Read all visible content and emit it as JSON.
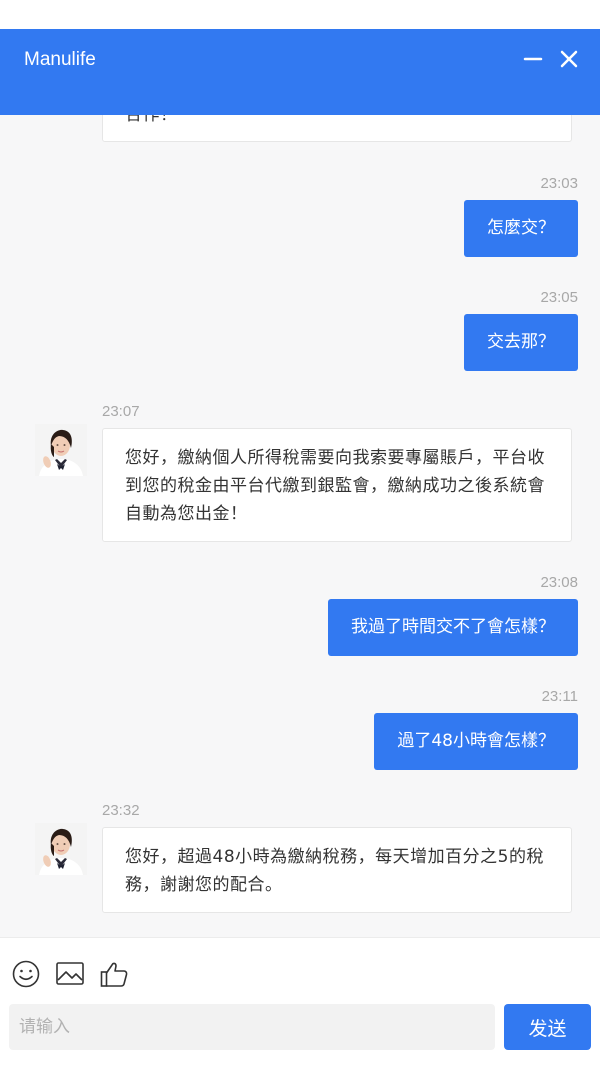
{
  "header": {
    "title": "Manulife",
    "minimize_icon": "minus-icon",
    "close_icon": "close-icon",
    "background": "#3279f1"
  },
  "messages": [
    {
      "direction": "in",
      "text": "合作！",
      "partial": true
    },
    {
      "direction": "out",
      "time": "23:03",
      "text": "怎麼交？"
    },
    {
      "direction": "out",
      "time": "23:05",
      "text": "交去那？"
    },
    {
      "direction": "in",
      "time": "23:07",
      "text": "您好，繳納個人所得稅需要向我索要專屬賬戶，平台收到您的稅金由平台代繳到銀監會，繳納成功之後系統會自動為您出金！"
    },
    {
      "direction": "out",
      "time": "23:08",
      "text": "我過了時間交不了會怎樣？"
    },
    {
      "direction": "out",
      "time": "23:11",
      "text": "過了48小時會怎樣？"
    },
    {
      "direction": "in",
      "time": "23:32",
      "text": "您好，超過48小時為繳納稅務，每天增加百分之5的稅務，謝謝您的配合。"
    }
  ],
  "toolbar": {
    "emoji_icon": "smiley-icon",
    "image_icon": "image-icon",
    "like_icon": "thumbs-up-icon"
  },
  "input": {
    "placeholder": "请输入",
    "value": ""
  },
  "send_label": "发送",
  "colors": {
    "accent": "#3279f1",
    "chat_bg": "#f7f7f8",
    "timestamp": "#a8a8a8"
  }
}
